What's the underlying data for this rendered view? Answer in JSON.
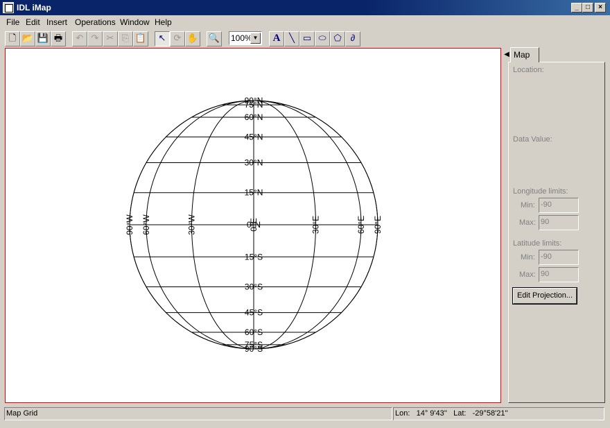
{
  "window": {
    "title": "IDL iMap",
    "controls": {
      "minimize": "_",
      "maximize": "□",
      "close": "×"
    }
  },
  "menu": [
    "File",
    "Edit",
    "Insert",
    "Operations",
    "Window",
    "Help"
  ],
  "toolbar": {
    "buttons": [
      {
        "name": "new-icon",
        "glyph": "🗋"
      },
      {
        "name": "open-icon",
        "glyph": "📂"
      },
      {
        "name": "save-icon",
        "glyph": "💾"
      },
      {
        "name": "print-icon",
        "glyph": "🖶"
      },
      {
        "name": "undo-icon",
        "glyph": "↶"
      },
      {
        "name": "redo-icon",
        "glyph": "↷"
      },
      {
        "name": "cut-icon",
        "glyph": "✂"
      },
      {
        "name": "copy-icon",
        "glyph": "⎘"
      },
      {
        "name": "paste-icon",
        "glyph": "📋"
      },
      {
        "name": "select-arrow-icon",
        "glyph": "↖"
      },
      {
        "name": "rotate-icon",
        "glyph": "⟳"
      },
      {
        "name": "pan-hand-icon",
        "glyph": "✋"
      },
      {
        "name": "zoom-magnifier-icon",
        "glyph": "🔍"
      },
      {
        "name": "text-tool-icon",
        "glyph": "A"
      },
      {
        "name": "line-tool-icon",
        "glyph": "╲"
      },
      {
        "name": "rectangle-tool-icon",
        "glyph": "▭"
      },
      {
        "name": "ellipse-tool-icon",
        "glyph": "⬭"
      },
      {
        "name": "polygon-tool-icon",
        "glyph": "⬠"
      },
      {
        "name": "freehand-tool-icon",
        "glyph": "∂"
      }
    ],
    "zoom": "100%"
  },
  "map": {
    "lat_labels_north": [
      "90°N",
      "75°N",
      "60°N",
      "45°N",
      "30°N",
      "15°N"
    ],
    "lat_label_equator": "0°N",
    "lat_labels_south": [
      "15°S",
      "30°S",
      "45°S",
      "60°S",
      "75°S",
      "90°S"
    ],
    "lon_labels": [
      "90°W",
      "60°W",
      "30°W",
      "0°E",
      "30°E",
      "60°E",
      "90°E"
    ],
    "lat_lines": [
      90,
      75,
      60,
      45,
      30,
      15,
      0,
      -15,
      -30,
      -45,
      -60,
      -75,
      -90
    ],
    "lon_lines": [
      -90,
      -60,
      -30,
      0,
      30,
      60,
      90
    ],
    "line_color": "#000000"
  },
  "panel": {
    "tab": "Map",
    "collapse_glyph": "◀",
    "location_label": "Location:",
    "data_value_label": "Data Value:",
    "longitude_limits_label": "Longitude limits:",
    "latitude_limits_label": "Latitude limits:",
    "min_label": "Min:",
    "max_label": "Max:",
    "lon_min": "-90",
    "lon_max": "90",
    "lat_min": "-90",
    "lat_max": "90",
    "edit_button": "Edit Projection..."
  },
  "status": {
    "left": "Map Grid",
    "right": "Lon:   14° 9'43''   Lat:   -29°58'21''"
  }
}
